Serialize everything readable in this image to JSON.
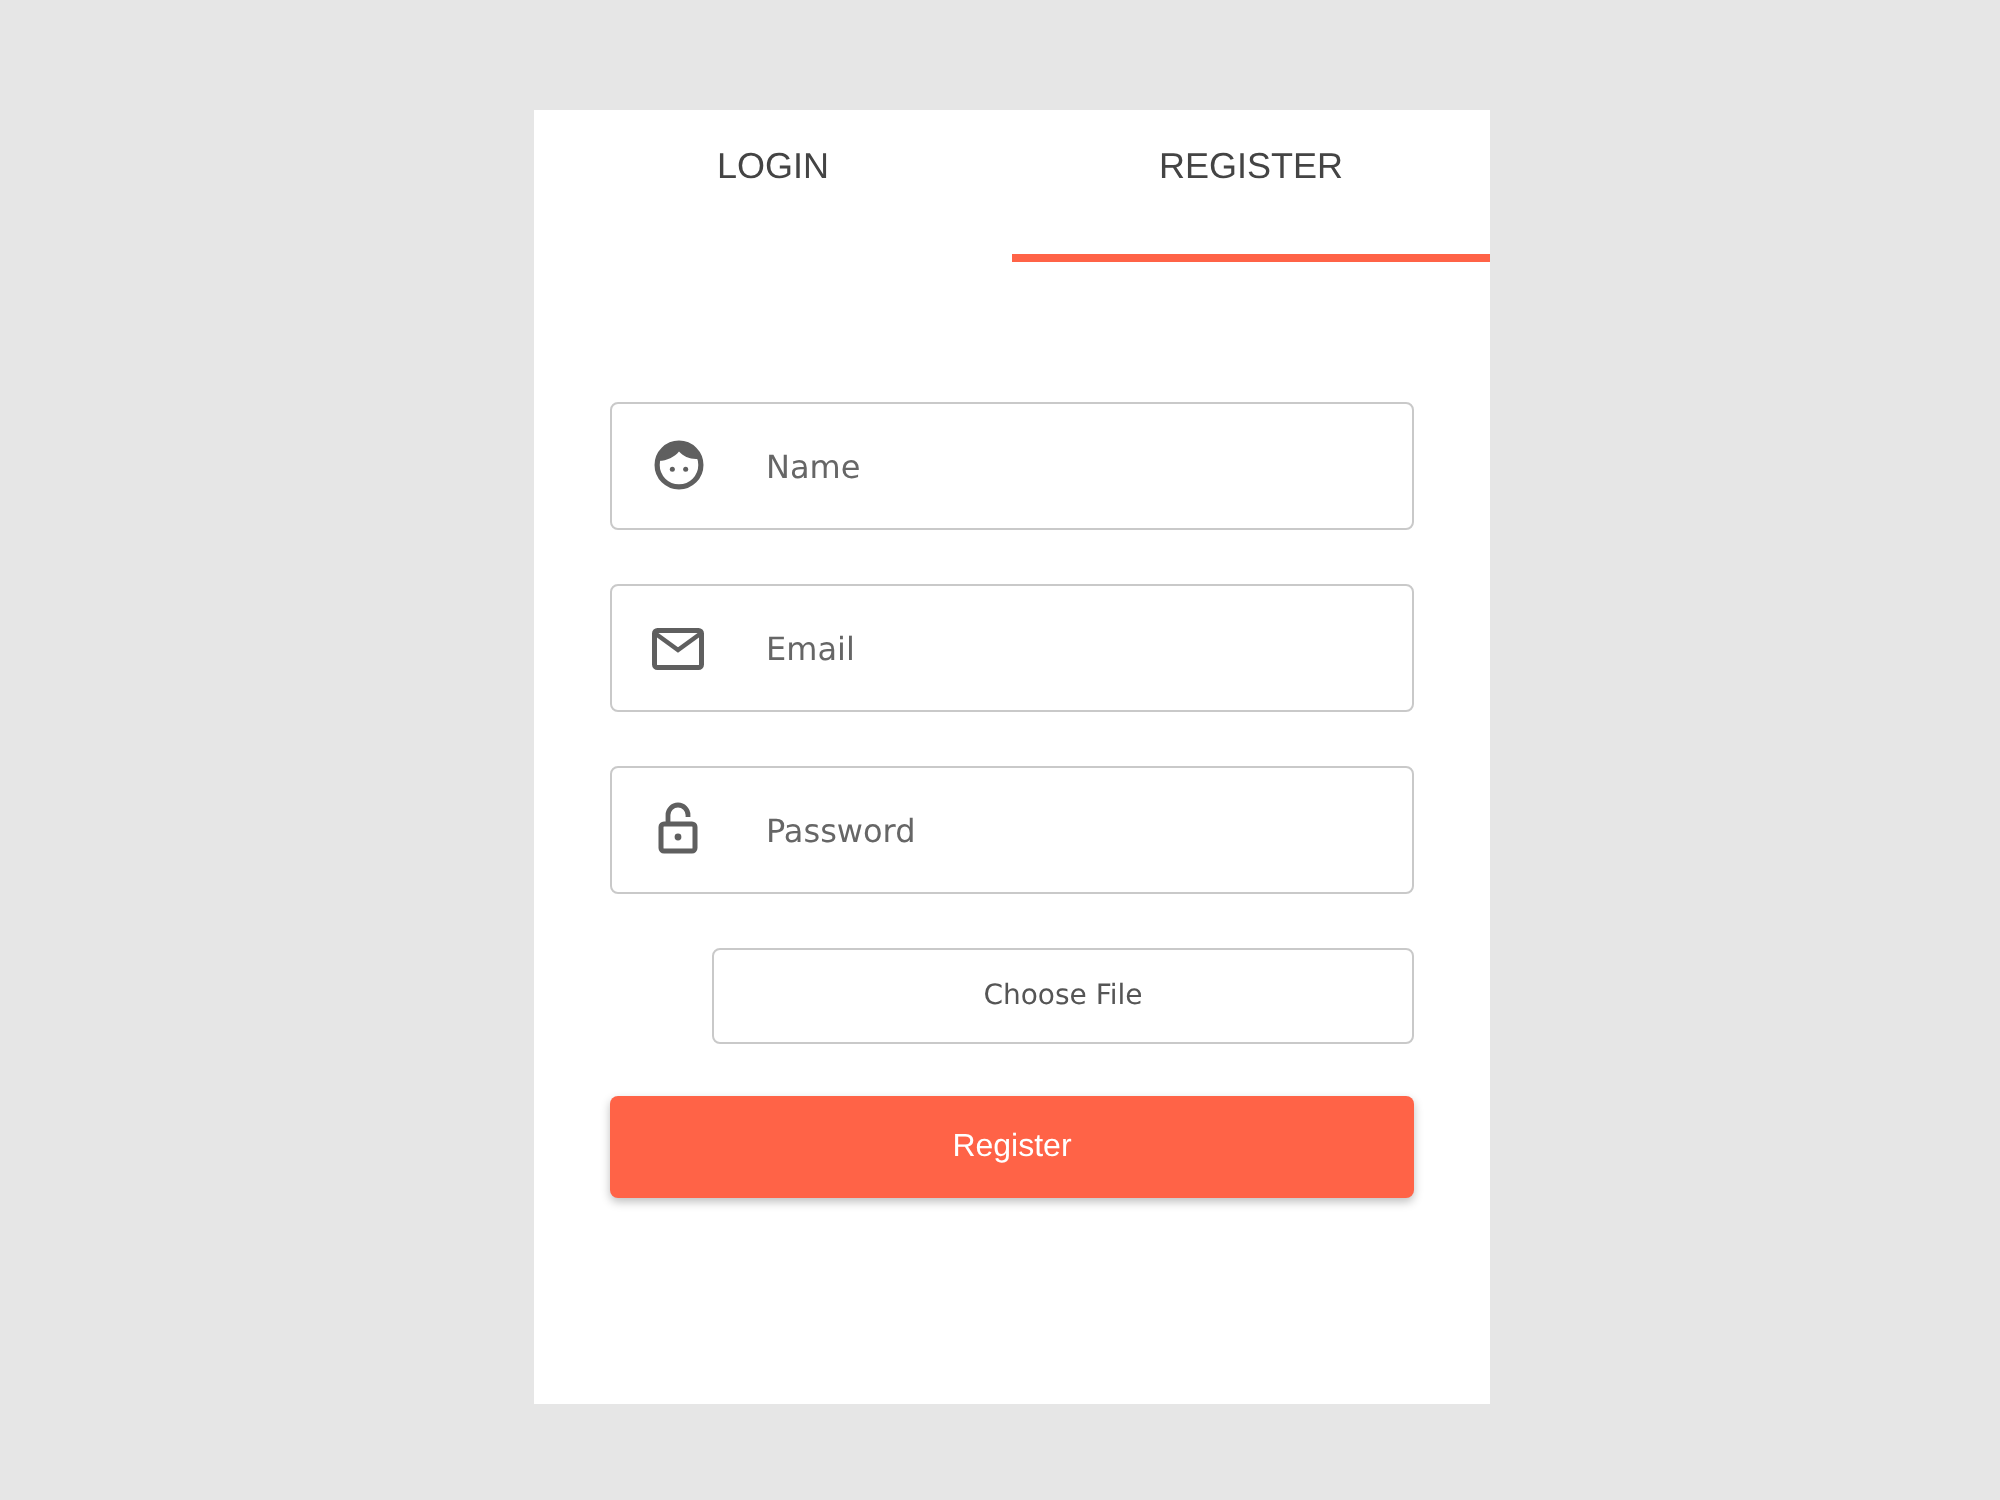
{
  "tabs": [
    {
      "label": "LOGIN",
      "selected": false
    },
    {
      "label": "REGISTER",
      "selected": true
    }
  ],
  "fields": [
    {
      "kind": "name",
      "placeholder": "Name"
    },
    {
      "kind": "email",
      "placeholder": "Email"
    },
    {
      "kind": "password",
      "placeholder": "Password"
    }
  ],
  "file_button": {
    "label": "Choose File"
  },
  "submit_button": {
    "label": "Register"
  }
}
